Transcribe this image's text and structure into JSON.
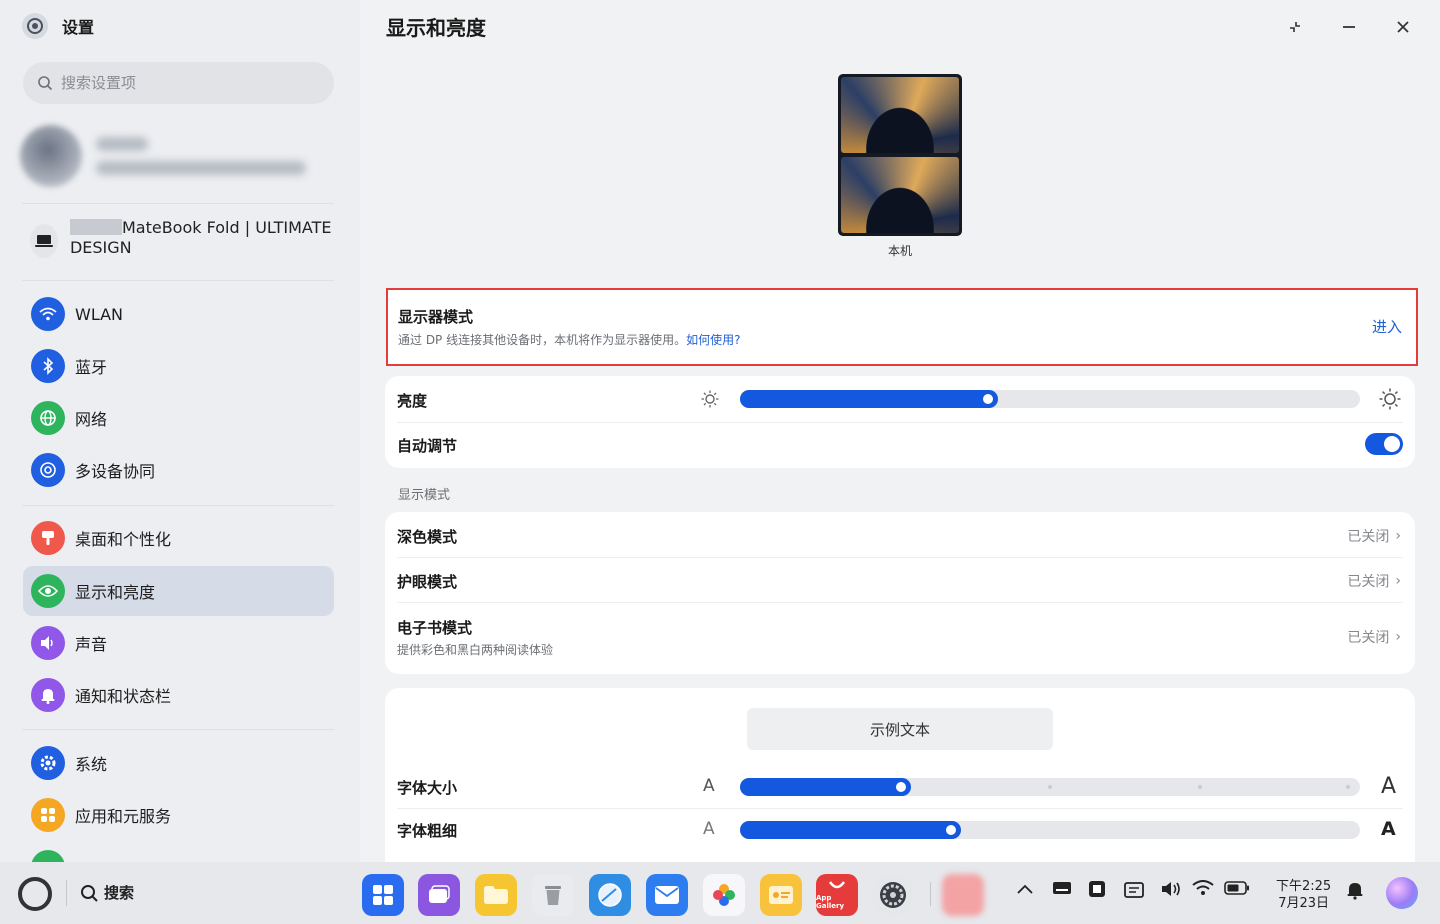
{
  "app": {
    "title": "设置"
  },
  "search": {
    "placeholder": "搜索设置项"
  },
  "device": {
    "name": "MateBook Fold | ULTIMATE DESIGN"
  },
  "sidebar": {
    "items": [
      {
        "label": "WLAN",
        "icon": "wifi-icon",
        "color": "#1f5fe0"
      },
      {
        "label": "蓝牙",
        "icon": "bluetooth-icon",
        "color": "#1f5fe0"
      },
      {
        "label": "网络",
        "icon": "globe-icon",
        "color": "#2db45c"
      },
      {
        "label": "多设备协同",
        "icon": "multi-device-icon",
        "color": "#1f5fe0"
      },
      {
        "label": "桌面和个性化",
        "icon": "brush-icon",
        "color": "#f0584c"
      },
      {
        "label": "显示和亮度",
        "icon": "eye-icon",
        "color": "#2db45c",
        "active": true
      },
      {
        "label": "声音",
        "icon": "speaker-icon",
        "color": "#9057e8"
      },
      {
        "label": "通知和状态栏",
        "icon": "bell-icon",
        "color": "#9057e8"
      },
      {
        "label": "系统",
        "icon": "gear-icon",
        "color": "#1f5fe0"
      },
      {
        "label": "应用和元服务",
        "icon": "apps-icon",
        "color": "#f5a623"
      }
    ]
  },
  "main": {
    "title": "显示和亮度",
    "preview_label": "本机",
    "monitor_mode": {
      "title": "显示器模式",
      "desc": "通过 DP 线连接其他设备时，本机将作为显示器使用。",
      "link": "如何使用?",
      "action": "进入"
    },
    "brightness": {
      "label": "亮度",
      "value": 0.4
    },
    "auto_adjust": {
      "label": "自动调节",
      "on": true
    },
    "display_mode_section": "显示模式",
    "modes": [
      {
        "label": "深色模式",
        "status": "已关闭"
      },
      {
        "label": "护眼模式",
        "status": "已关闭"
      },
      {
        "label": "电子书模式",
        "sub": "提供彩色和黑白两种阅读体验",
        "status": "已关闭"
      }
    ],
    "sample_text": "示例文本",
    "font_size": {
      "label": "字体大小",
      "value": 0.26,
      "small": "A",
      "large": "A"
    },
    "font_weight": {
      "label": "字体粗细",
      "value": 0.34,
      "small": "A",
      "large": "A"
    }
  },
  "taskbar": {
    "search": "搜索",
    "app_gallery": "App Gallery",
    "time": "下午2:25",
    "date": "7月23日"
  },
  "colors": {
    "accent": "#1558e0",
    "highlight_border": "#e43b3b"
  }
}
